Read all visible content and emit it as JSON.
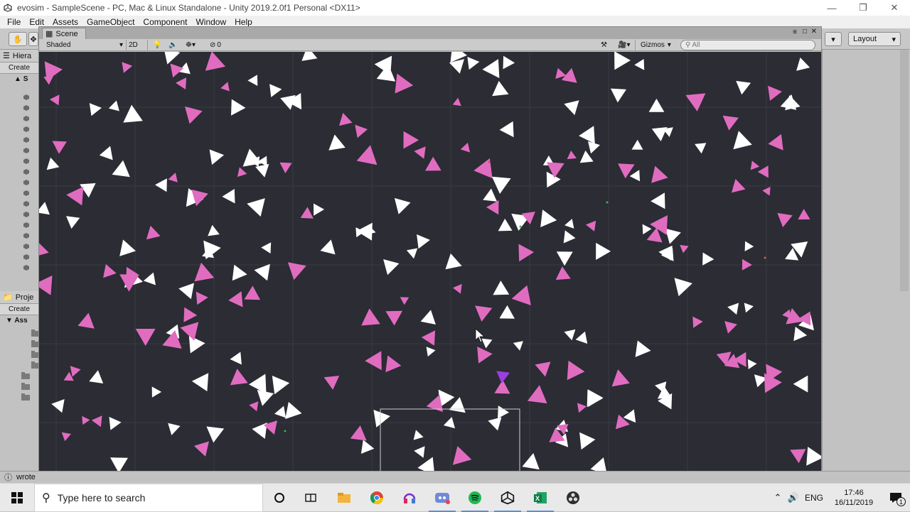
{
  "window": {
    "title": "evosim - SampleScene - PC, Mac & Linux Standalone - Unity 2019.2.0f1 Personal <DX11>",
    "controls": [
      "minimize",
      "restore",
      "close"
    ]
  },
  "menu": [
    "File",
    "Edit",
    "Assets",
    "GameObject",
    "Component",
    "Window",
    "Help"
  ],
  "toolbar": {
    "layout_label": "Layout"
  },
  "hierarchy": {
    "tab_label": "Hiera",
    "create_label": "Create",
    "scene_root": "S"
  },
  "project": {
    "tab_label": "Proje",
    "create_label": "Create",
    "assets_label": "Ass"
  },
  "scene": {
    "tab_label": "Scene",
    "shading_mode": "Shaded",
    "mode_2d": "2D",
    "hidden_count": "0",
    "gizmos_label": "Gizmos",
    "search_placeholder": "All",
    "colors": {
      "background": "#2b2c34",
      "grid": "#3a3b44",
      "white_agent": "#ffffff",
      "pink_agent": "#e06cc0",
      "purple_agent": "#9b3fe0",
      "food_green": "#3fb24f",
      "food_red": "#e2563a"
    }
  },
  "status": {
    "message": "wrote"
  },
  "taskbar": {
    "search_placeholder": "Type here to search",
    "apps": [
      "cortana-icon",
      "task-view-icon",
      "file-explorer-icon",
      "chrome-icon",
      "headphones-app-icon",
      "discord-icon",
      "spotify-icon",
      "unity-icon",
      "excel-icon",
      "obs-icon"
    ],
    "language": "ENG",
    "time": "17:46",
    "date": "16/11/2019",
    "notification_count": "1"
  }
}
